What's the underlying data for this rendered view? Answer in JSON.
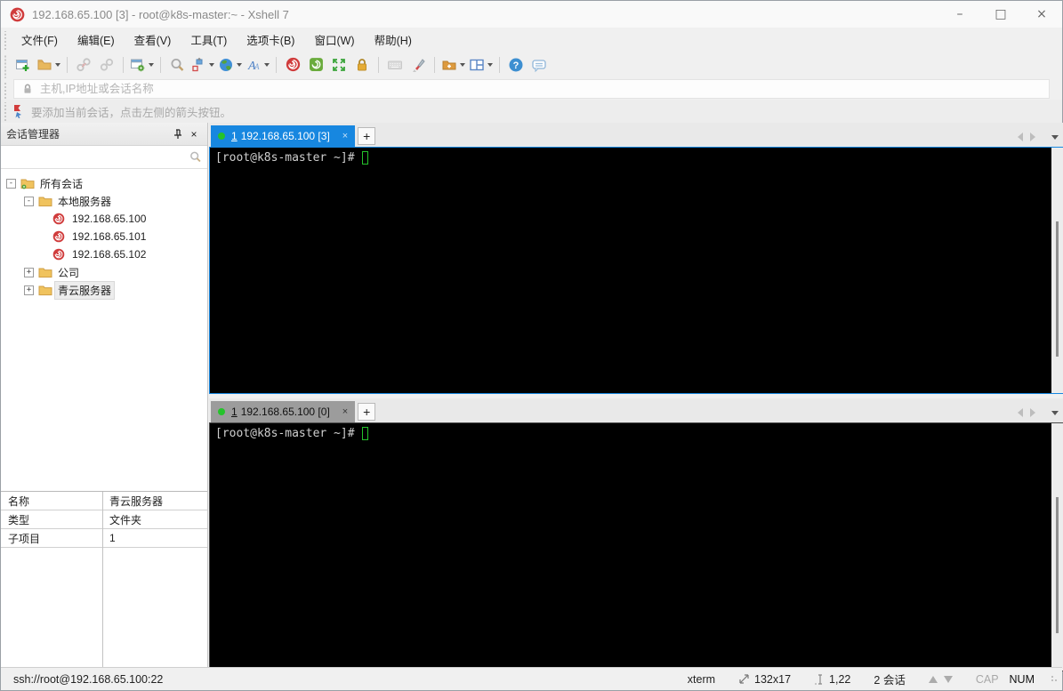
{
  "window": {
    "title": "192.168.65.100 [3] - root@k8s-master:~ - Xshell 7",
    "minimize": "–",
    "maximize": "□",
    "close": "×"
  },
  "menu": {
    "items": [
      "文件(F)",
      "编辑(E)",
      "查看(V)",
      "工具(T)",
      "选项卡(B)",
      "窗口(W)",
      "帮助(H)"
    ]
  },
  "toolbar": {
    "icons": [
      "new-session",
      "open-session-folder",
      "disconnect",
      "reconnect",
      "session-properties",
      "find",
      "compose-pane",
      "encoding-globe",
      "font",
      "xagent-logo",
      "xftp",
      "fullscreen",
      "lock-screen",
      "virtual-keyboard",
      "highlighter",
      "new-file",
      "tile-layout",
      "help",
      "feedback"
    ]
  },
  "address_bar": {
    "placeholder": "主机,IP地址或会话名称"
  },
  "info_bar": {
    "text": "要添加当前会话，点击左侧的箭头按钮。"
  },
  "session_manager": {
    "title": "会话管理器",
    "tree": [
      {
        "label": "所有会话",
        "type": "root-folder",
        "expander": "-"
      },
      {
        "label": "本地服务器",
        "type": "folder",
        "expander": "-"
      },
      {
        "label": "192.168.65.100",
        "type": "session"
      },
      {
        "label": "192.168.65.101",
        "type": "session"
      },
      {
        "label": "192.168.65.102",
        "type": "session"
      },
      {
        "label": "公司",
        "type": "folder",
        "expander": "+"
      },
      {
        "label": "青云服务器",
        "type": "folder",
        "expander": "+",
        "selected": true
      }
    ],
    "properties": {
      "rows": [
        {
          "key": "名称",
          "value": "青云服务器"
        },
        {
          "key": "类型",
          "value": "文件夹"
        },
        {
          "key": "子项目",
          "value": "1"
        }
      ]
    }
  },
  "terminal": {
    "panes": [
      {
        "tab_index": "1",
        "tab_label": "192.168.65.100 [3]",
        "close": "×",
        "new_tab": "+",
        "prompt": "[root@k8s-master ~]# "
      },
      {
        "tab_index": "1",
        "tab_label": "192.168.65.100 [0]",
        "close": "×",
        "new_tab": "+",
        "prompt": "[root@k8s-master ~]# "
      }
    ]
  },
  "status_bar": {
    "url": "ssh://root@192.168.65.100:22",
    "term_type": "xterm",
    "term_size": "132x17",
    "cursor_pos": "1,22",
    "session_count": "2 会话",
    "cap": "CAP",
    "num": "NUM"
  },
  "colors": {
    "active_tab": "#1787e0",
    "connected_dot": "#25c32b",
    "terminal_bg": "#000000",
    "terminal_text": "#cfcfcf",
    "brand_red": "#d03c3c"
  }
}
